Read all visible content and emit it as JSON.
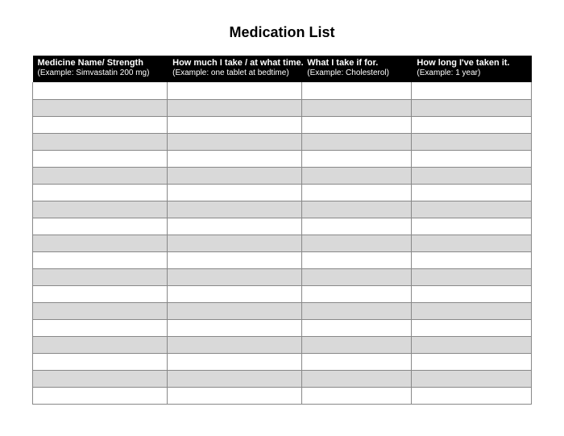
{
  "title": "Medication List",
  "columns": [
    {
      "header": "Medicine Name/ Strength",
      "example": "(Example: Simvastatin 200 mg)"
    },
    {
      "header": "How much I take / at what time.",
      "example": "(Example: one tablet at bedtime)"
    },
    {
      "header": "What I take if for.",
      "example": "(Example: Cholesterol)"
    },
    {
      "header": "How long I've taken it.",
      "example": "(Example: 1 year)"
    }
  ],
  "row_count": 19,
  "rows": [
    [
      "",
      "",
      "",
      ""
    ],
    [
      "",
      "",
      "",
      ""
    ],
    [
      "",
      "",
      "",
      ""
    ],
    [
      "",
      "",
      "",
      ""
    ],
    [
      "",
      "",
      "",
      ""
    ],
    [
      "",
      "",
      "",
      ""
    ],
    [
      "",
      "",
      "",
      ""
    ],
    [
      "",
      "",
      "",
      ""
    ],
    [
      "",
      "",
      "",
      ""
    ],
    [
      "",
      "",
      "",
      ""
    ],
    [
      "",
      "",
      "",
      ""
    ],
    [
      "",
      "",
      "",
      ""
    ],
    [
      "",
      "",
      "",
      ""
    ],
    [
      "",
      "",
      "",
      ""
    ],
    [
      "",
      "",
      "",
      ""
    ],
    [
      "",
      "",
      "",
      ""
    ],
    [
      "",
      "",
      "",
      ""
    ],
    [
      "",
      "",
      "",
      ""
    ],
    [
      "",
      "",
      "",
      ""
    ]
  ]
}
